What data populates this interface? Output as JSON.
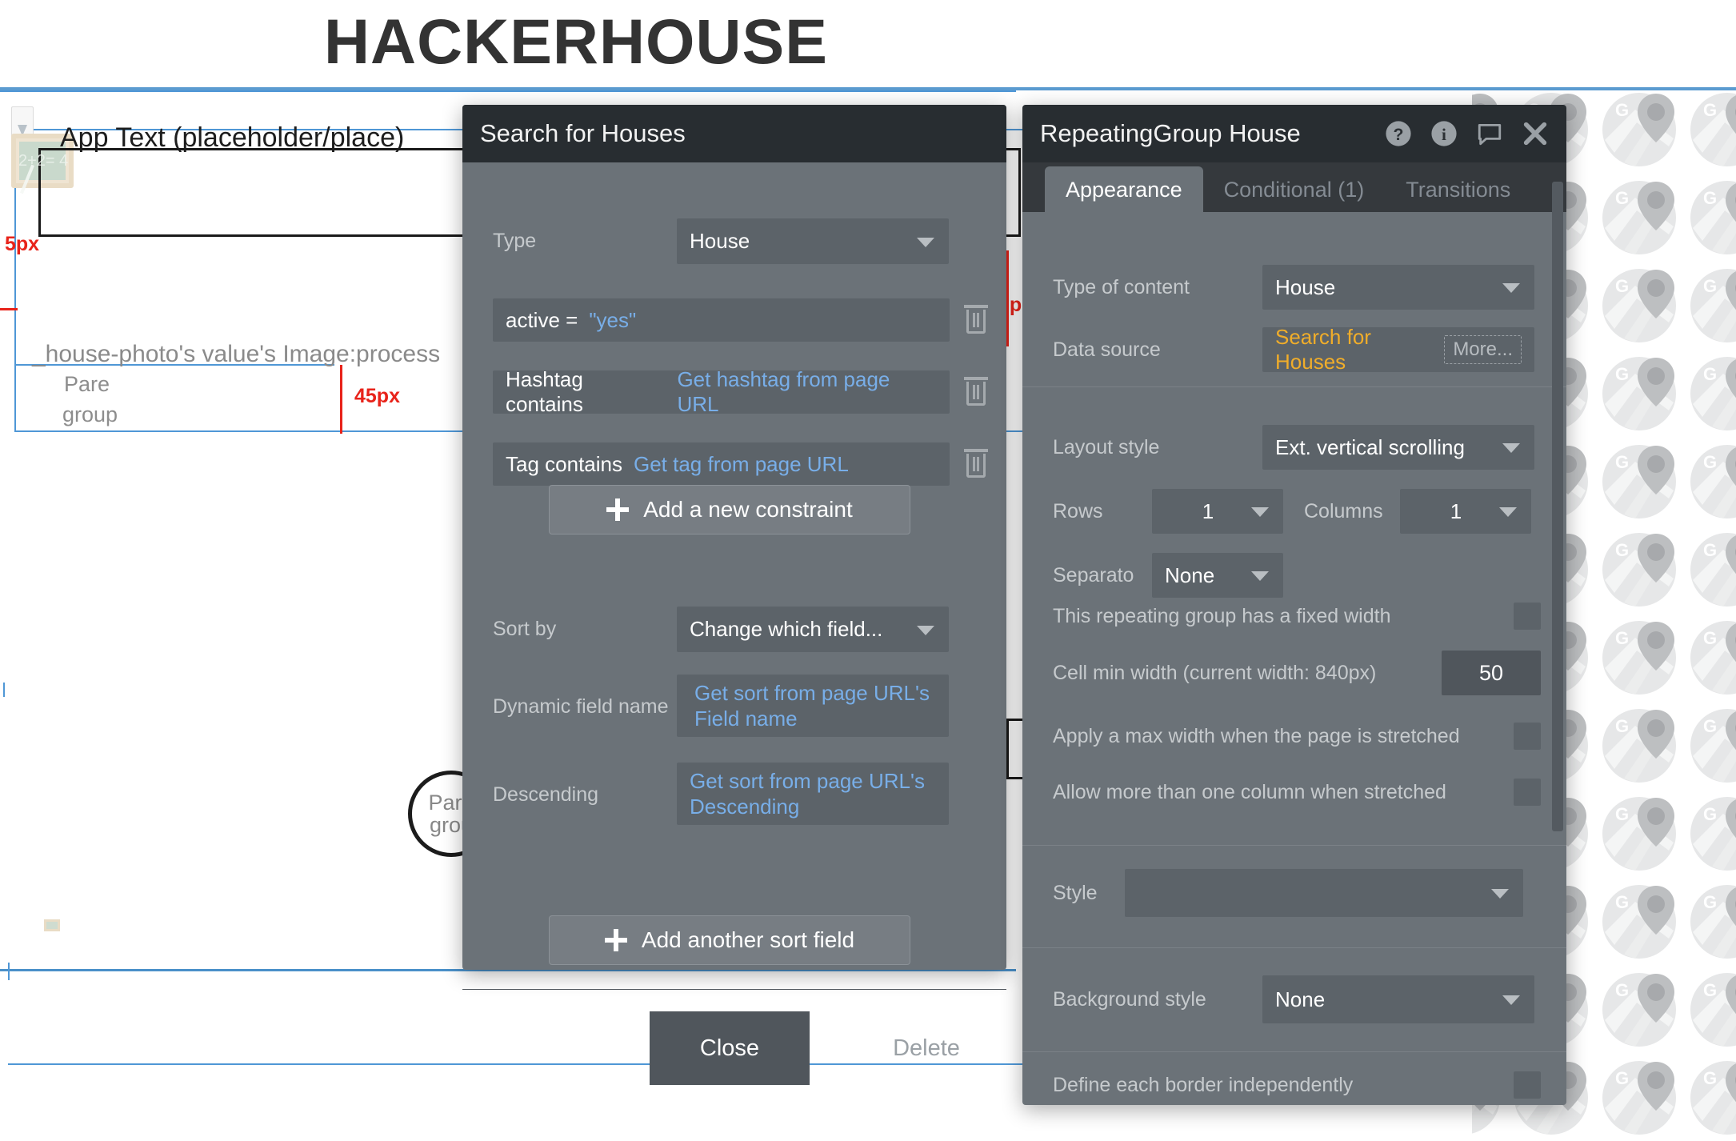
{
  "site": {
    "title": "HACKERHOUSE"
  },
  "canvas": {
    "app_text": "App Text (placeholder/place)",
    "ghost_expression": "_house-photo's value's Image:process",
    "parent_group_label_1": "Pare",
    "parent_group_label_2": "group",
    "circle_label_line1": "Pare",
    "circle_label_line2": "grou",
    "measure_5px": "5px",
    "measure_45px": "45px",
    "chalk_glyph": "2+2= 4"
  },
  "search_dialog": {
    "title": "Search for Houses",
    "type_label": "Type",
    "type_value": "House",
    "constraints": [
      {
        "field": "active =",
        "value": "\"yes\"",
        "dynamic": true
      },
      {
        "field": "Hashtag contains",
        "value": "Get hashtag from page URL",
        "dynamic": true
      },
      {
        "field": "Tag contains",
        "value": "Get tag from page URL",
        "dynamic": true
      }
    ],
    "add_constraint_label": "Add a new constraint",
    "sort_by_label": "Sort by",
    "sort_by_value": "Change which field...",
    "dynamic_field_label": "Dynamic field name",
    "dynamic_field_value": "Get sort from page URL's Field name",
    "descending_label": "Descending",
    "descending_value": "Get sort from page URL's Descending",
    "add_sort_label": "Add another sort field",
    "close_label": "Close",
    "delete_label": "Delete"
  },
  "rg_panel": {
    "title": "RepeatingGroup House",
    "icons": [
      "help-icon",
      "info-icon",
      "comment-icon",
      "close-icon"
    ],
    "tabs": [
      {
        "label": "Appearance",
        "active": true
      },
      {
        "label": "Conditional (1)",
        "active": false
      },
      {
        "label": "Transitions",
        "active": false
      }
    ],
    "type_of_content_label": "Type of content",
    "type_of_content_value": "House",
    "data_source_label": "Data source",
    "data_source_value": "Search for Houses",
    "data_source_more": "More...",
    "layout_style_label": "Layout style",
    "layout_style_value": "Ext. vertical scrolling",
    "rows_label": "Rows",
    "rows_value": "1",
    "columns_label": "Columns",
    "columns_value": "1",
    "separator_label": "Separato",
    "separator_value": "None",
    "fixed_width_label": "This repeating group has a fixed width",
    "cell_min_width_label": "Cell min width (current width: 840px)",
    "cell_min_width_value": "50",
    "max_width_label": "Apply a max width when the page is stretched",
    "multi_column_label": "Allow more than one column when stretched",
    "style_label": "Style",
    "style_value": "",
    "background_style_label": "Background style",
    "background_style_value": "None",
    "define_border_label": "Define each border independently"
  },
  "colors": {
    "titlebar": "#282d31",
    "panel": "#6b7278",
    "field": "#5c6369",
    "accent_dynamic": "#78aee8",
    "accent_gold": "#f0ad2a",
    "guide_blue": "#4f97d6",
    "measure_red": "#e8231a"
  }
}
